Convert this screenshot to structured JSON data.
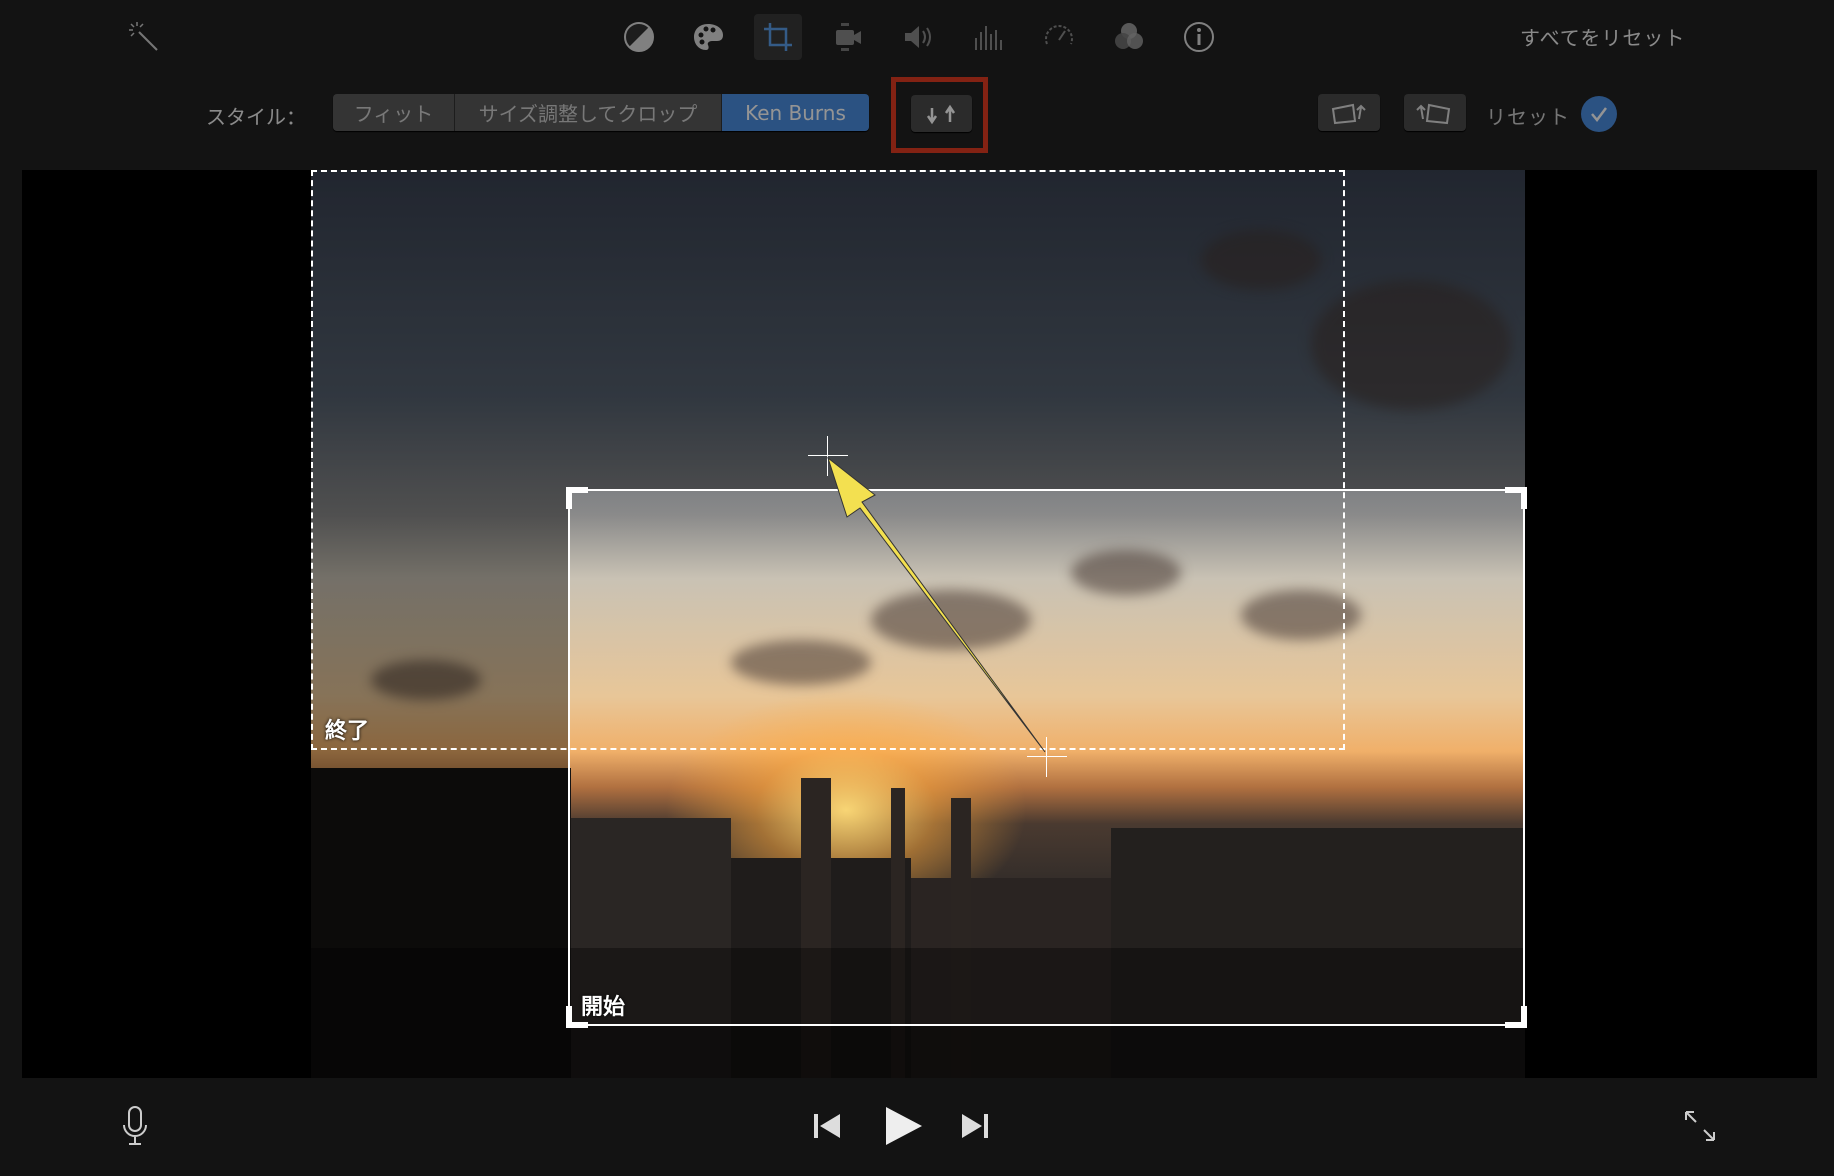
{
  "toolbar": {
    "tools": [
      "magic-wand",
      "color-balance",
      "color-correction",
      "cropping",
      "stabilization",
      "volume",
      "noise-reduction-equalizer",
      "speed",
      "clip-filter",
      "clip-info"
    ],
    "active_tool": "cropping",
    "reset_all_label": "すべてをリセット"
  },
  "crop": {
    "style_label": "スタイル：",
    "styles": [
      "フィット",
      "サイズ調整してクロップ",
      "Ken Burns"
    ],
    "selected_style": "Ken Burns",
    "reset_label": "リセット",
    "accent": "#4a8de0",
    "highlight": "#e23b22"
  },
  "viewer": {
    "end_label": "終了",
    "start_label": "開始"
  }
}
